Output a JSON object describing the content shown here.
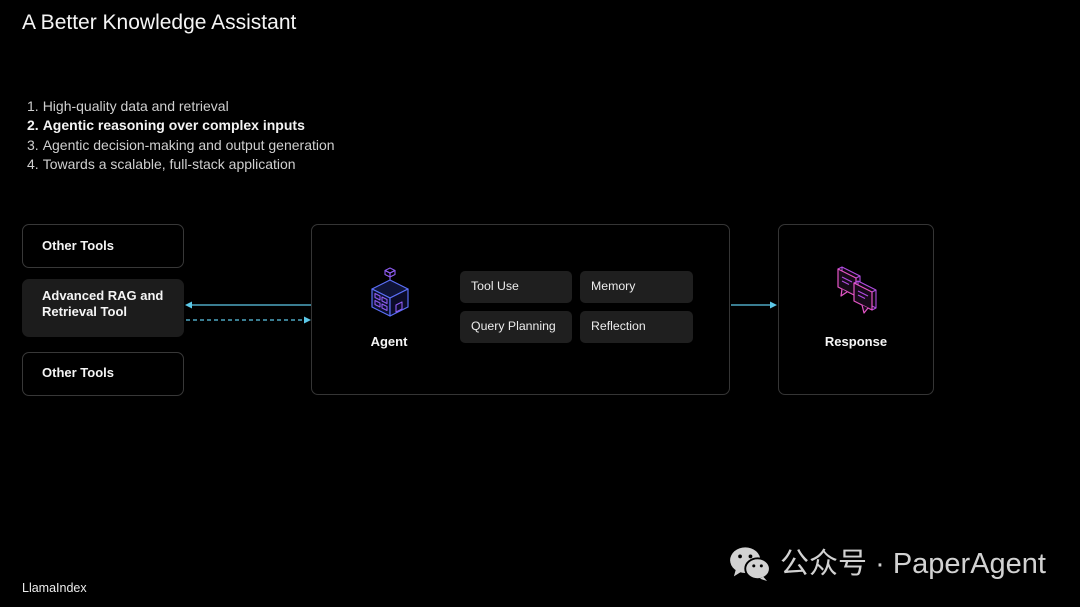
{
  "theme": {
    "background": "#000000",
    "arrow": "#5cc8e8",
    "agent_icon": "#5b6ff7",
    "agent_icon_accent": "#8f5cf2",
    "response_icon": "#e455c6",
    "response_icon_accent": "#b14ce0"
  },
  "slide": {
    "title": "A Better Knowledge Assistant",
    "agenda": [
      {
        "number": "1.",
        "text": "High-quality data and retrieval",
        "emphasized": false
      },
      {
        "number": "2.",
        "text": "Agentic reasoning over complex inputs",
        "emphasized": true
      },
      {
        "number": "3.",
        "text": "Agentic decision-making and output generation",
        "emphasized": false
      },
      {
        "number": "4.",
        "text": "Towards a scalable, full-stack application",
        "emphasized": false
      }
    ]
  },
  "diagram": {
    "tools": [
      {
        "label": "Other Tools",
        "highlighted": false
      },
      {
        "label": "Advanced RAG and Retrieval Tool",
        "highlighted": true
      },
      {
        "label": "Other Tools",
        "highlighted": false
      }
    ],
    "agent": {
      "label": "Agent",
      "icon": "agent-building-icon",
      "capabilities": [
        "Tool Use",
        "Memory",
        "Query Planning",
        "Reflection"
      ]
    },
    "response": {
      "label": "Response",
      "icon": "response-chat-icon"
    }
  },
  "footer": {
    "brand": "LlamaIndex"
  },
  "watermark": {
    "icon": "wechat-icon",
    "text": "公众号 · PaperAgent"
  }
}
